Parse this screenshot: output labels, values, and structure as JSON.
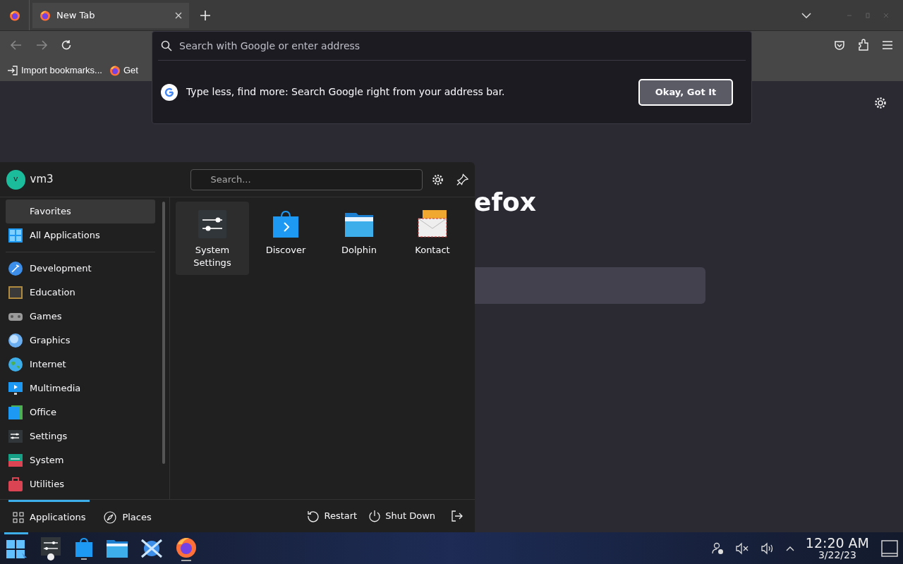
{
  "browser": {
    "tabs": [
      {
        "label": "New Tab",
        "selected": true
      }
    ],
    "url_bar": {
      "placeholder": "Search with Google or enter address"
    },
    "bookmarks": [
      "Import bookmarks...",
      "Get"
    ],
    "suggestion": {
      "text": "Type less, find more: Search Google right from your address bar.",
      "button": "Okay, Got It"
    },
    "page": {
      "heading": "efox"
    }
  },
  "launcher": {
    "user": {
      "initial": "v",
      "name": "vm3"
    },
    "search": {
      "placeholder": "Search..."
    },
    "categories": [
      {
        "label": "Favorites",
        "selected": true
      },
      {
        "label": "All Applications",
        "selected": false
      },
      {
        "label": "Development",
        "selected": false
      },
      {
        "label": "Education",
        "selected": false
      },
      {
        "label": "Games",
        "selected": false
      },
      {
        "label": "Graphics",
        "selected": false
      },
      {
        "label": "Internet",
        "selected": false
      },
      {
        "label": "Multimedia",
        "selected": false
      },
      {
        "label": "Office",
        "selected": false
      },
      {
        "label": "Settings",
        "selected": false
      },
      {
        "label": "System",
        "selected": false
      },
      {
        "label": "Utilities",
        "selected": false
      }
    ],
    "apps": [
      {
        "label": "System Settings",
        "selected": true
      },
      {
        "label": "Discover",
        "selected": false
      },
      {
        "label": "Dolphin",
        "selected": false
      },
      {
        "label": "Kontact",
        "selected": false
      }
    ],
    "tabs": [
      {
        "label": "Applications",
        "selected": true
      },
      {
        "label": "Places",
        "selected": false
      }
    ],
    "actions": [
      "Restart",
      "Shut Down"
    ]
  },
  "taskbar": {
    "time": "12:20 AM",
    "date": "3/22/23"
  }
}
